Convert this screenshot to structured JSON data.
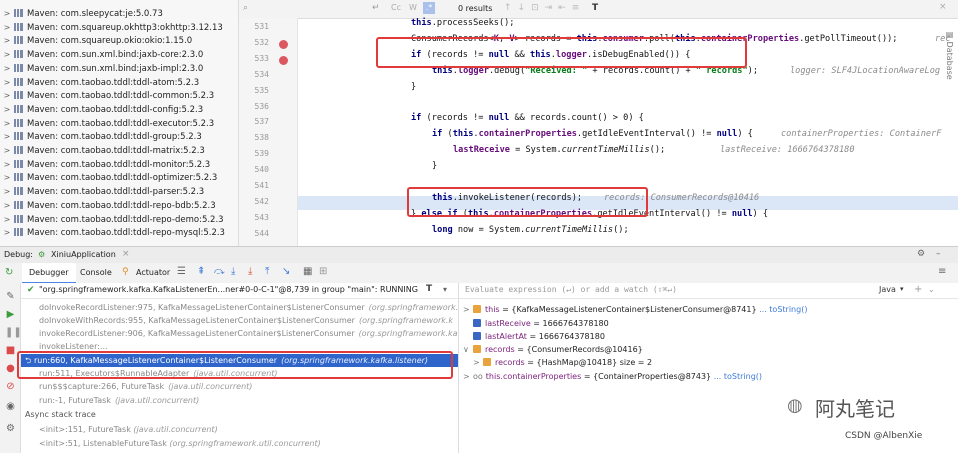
{
  "project_tree": {
    "items": [
      "Maven: com.sleepycat:je:5.0.73",
      "Maven: com.squareup.okhttp3:okhttp:3.12.13",
      "Maven: com.squareup.okio:okio:1.15.0",
      "Maven: com.sun.xml.bind:jaxb-core:2.3.0",
      "Maven: com.sun.xml.bind:jaxb-impl:2.3.0",
      "Maven: com.taobao.tddl:tddl-atom:5.2.3",
      "Maven: com.taobao.tddl:tddl-common:5.2.3",
      "Maven: com.taobao.tddl:tddl-config:5.2.3",
      "Maven: com.taobao.tddl:tddl-executor:5.2.3",
      "Maven: com.taobao.tddl:tddl-group:5.2.3",
      "Maven: com.taobao.tddl:tddl-matrix:5.2.3",
      "Maven: com.taobao.tddl:tddl-monitor:5.2.3",
      "Maven: com.taobao.tddl:tddl-optimizer:5.2.3",
      "Maven: com.taobao.tddl:tddl-parser:5.2.3",
      "Maven: com.taobao.tddl:tddl-repo-bdb:5.2.3",
      "Maven: com.taobao.tddl:tddl-repo-demo:5.2.3",
      "Maven: com.taobao.tddl:tddl-repo-mysql:5.2.3"
    ]
  },
  "find_bar": {
    "results": "0 results"
  },
  "editor": {
    "line_numbers": [
      "531",
      "532",
      "533",
      "534",
      "535",
      "536",
      "537",
      "538",
      "539",
      "540",
      "541",
      "542",
      "543",
      "544"
    ],
    "lines": {
      "l531": "this.processSeeks();",
      "l532a": "ConsumerRecords<K, V> records = ",
      "l532b": "this.consumer.poll(this.containerProperties.getPollTimeout());",
      "l532hint": "rec",
      "l533a": "if (records != null && this.logger.isDebugEnabled()) {",
      "l534a": "this.logger.debug(\"Received: \" + records.count() + \" records\");",
      "l534hint": "logger: SLF4JLocationAwareLog",
      "l535": "}",
      "l537": "if (records != null && records.count() > 0) {",
      "l538": "if (this.containerProperties.getIdleEventInterval() != null) {",
      "l538hint": "containerProperties: ContainerF",
      "l539": "lastReceive = System.currentTimeMillis();",
      "l539hint": "lastReceive: 1666764378180",
      "l540": "}",
      "l542": "this.invokeListener(records);",
      "l542hint": "records: ConsumerRecords@10416",
      "l543": "} else if (this.containerProperties.getIdleEventInterval() != null) {",
      "l544": "long now = System.currentTimeMillis();"
    }
  },
  "debug": {
    "label": "Debug:",
    "config": "XiniuApplication",
    "tabs": [
      "Debugger",
      "Console",
      "Actuator"
    ],
    "thread": "\"org.springframework.kafka.KafkaListenerEn...ner#0-0-C-1\"@8,739 in group \"main\": RUNNING",
    "frames": [
      {
        "method": "doInvokeRecordListener:975, KafkaMessageListenerContainer$ListenerConsumer",
        "pkg": "(org.springframework.k"
      },
      {
        "method": "doInvokeWithRecords:955, KafkaMessageListenerContainer$ListenerConsumer",
        "pkg": "(org.springframework.k"
      },
      {
        "method": "invokeRecordListener:906, KafkaMessageListenerContainer$ListenerConsumer",
        "pkg": "(org.springframework.kaf"
      },
      {
        "method": "invokeListener:...",
        "pkg": ""
      },
      {
        "method": "run:660, KafkaMessageListenerContainer$ListenerConsumer",
        "pkg": "(org.springframework.kafka.listener)"
      },
      {
        "method": "run:511, Executors$RunnableAdapter",
        "pkg": "(java.util.concurrent)"
      },
      {
        "method": "run$$$capture:266, FutureTask",
        "pkg": "(java.util.concurrent)"
      },
      {
        "method": "run:-1, FutureTask",
        "pkg": "(java.util.concurrent)"
      }
    ],
    "async_label": "Async stack trace",
    "async_frames": [
      {
        "method": "<init>:151, FutureTask",
        "pkg": "(java.util.concurrent)"
      },
      {
        "method": "<init>:51, ListenableFutureTask",
        "pkg": "(org.springframework.util.concurrent)"
      }
    ],
    "eval_placeholder": "Evaluate expression (↵) or add a watch (⇧⌘↵)",
    "lang": "Java",
    "vars": [
      {
        "name": "this",
        "value": "= {KafkaMessageListenerContainer$ListenerConsumer@8741}",
        "link": "... toString()",
        "color": "#e8a33d"
      },
      {
        "name": "lastReceive",
        "value": "= 1666764378180",
        "link": "",
        "color": "#3b67c4"
      },
      {
        "name": "lastAlertAt",
        "value": "= 1666764378180",
        "link": "",
        "color": "#3b67c4"
      },
      {
        "name": "records",
        "value": "= {ConsumerRecords@10416}",
        "link": "",
        "color": "#e8a33d"
      },
      {
        "name": "records",
        "value": "= {HashMap@10418}  size = 2",
        "link": "",
        "color": "#e8a33d"
      },
      {
        "name": "this.containerProperties",
        "value": "= {ContainerProperties@8743}",
        "link": "... toString()",
        "color": ""
      }
    ]
  },
  "watermark": {
    "brand": "阿丸笔记",
    "credit": "CSDN @AlbenXie"
  }
}
